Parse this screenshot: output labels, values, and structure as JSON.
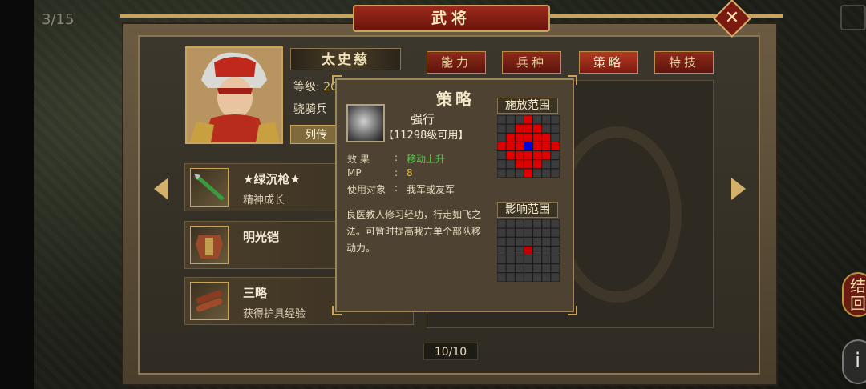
{
  "hud": {
    "page_count": "3/15",
    "side_button": "结\n回",
    "side_button2": "i"
  },
  "window": {
    "title": "武将"
  },
  "general": {
    "name": "太史慈",
    "level_label": "等级:",
    "level_value": "20",
    "unit_type": "骁骑兵",
    "bio_button": "列传"
  },
  "tabs": [
    {
      "label": "能力",
      "active": false
    },
    {
      "label": "兵种",
      "active": false
    },
    {
      "label": "策略",
      "active": true
    },
    {
      "label": "特技",
      "active": false
    }
  ],
  "items": [
    {
      "name": "★绿沉枪★",
      "desc": "精神成长"
    },
    {
      "name": "明光铠",
      "desc": ""
    },
    {
      "name": "三略",
      "desc": "获得护具经验"
    }
  ],
  "pager": "10/10",
  "popup": {
    "title": "策略",
    "skill_name": "强行",
    "skill_requirement": "【11298级可用】",
    "effect_label": "效 果",
    "effect_value": "移动上升",
    "mp_label": "MP",
    "mp_value": "8",
    "target_label": "使用对象",
    "target_value": "我军或友军",
    "description": "良医教人修习轻功，行走如飞之法。可暂时提高我方单个部队移动力。",
    "cast_range_label": "施放范围",
    "effect_range_label": "影响范围"
  },
  "colors": {
    "effect_value": "#4fd04a",
    "mp_value": "#e0b840",
    "range_red": "#e00000",
    "range_center": "#0000e0",
    "grid_cell": "#3c3c3c"
  }
}
